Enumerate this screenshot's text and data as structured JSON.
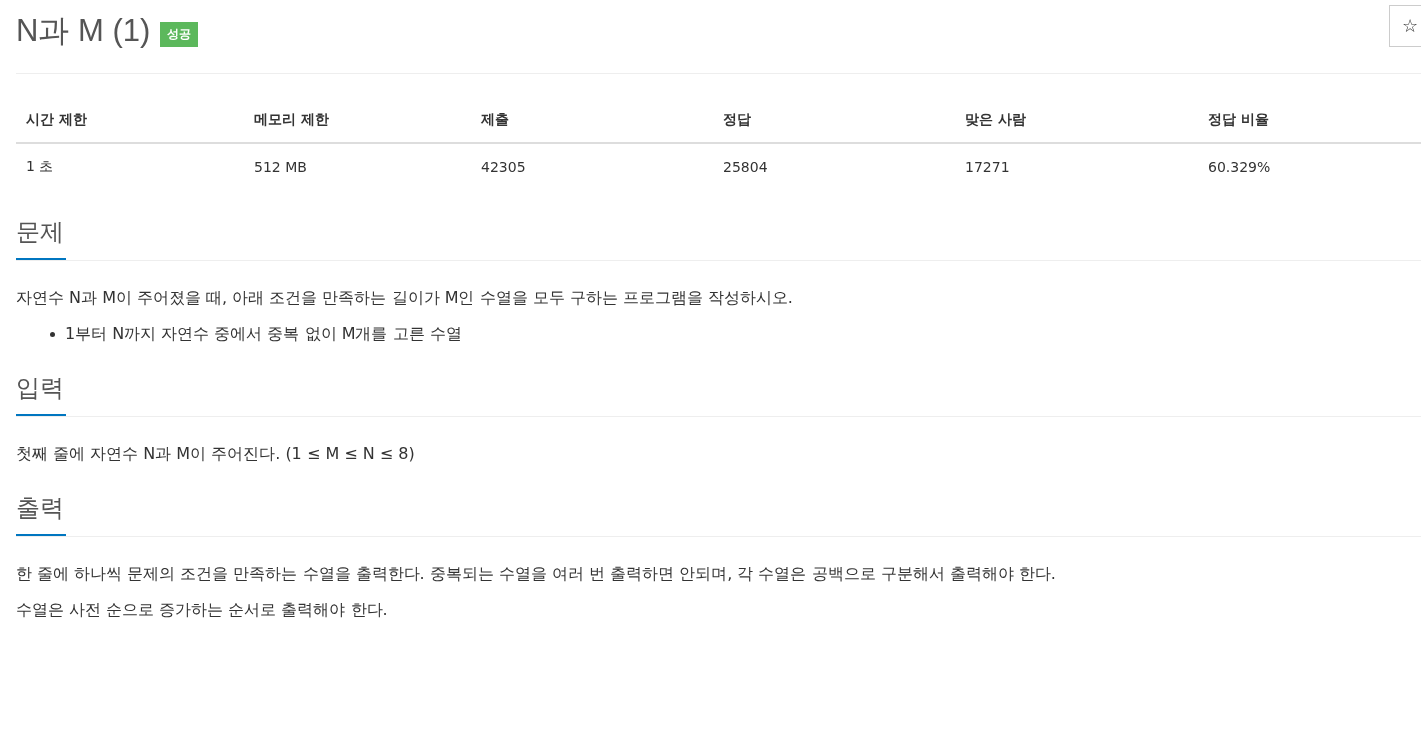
{
  "title": "N과 M (1)",
  "badge": "성공",
  "star_button": "☆",
  "table": {
    "columns": [
      "시간 제한",
      "메모리 제한",
      "제출",
      "정답",
      "맞은 사람",
      "정답 비율"
    ],
    "rows": [
      [
        "1 초",
        "512 MB",
        "42305",
        "25804",
        "17271",
        "60.329%"
      ]
    ]
  },
  "sections": [
    {
      "heading": "문제",
      "blocks": [
        {
          "kind": "paragraph",
          "text": "자연수 N과 M이 주어졌을 때, 아래 조건을 만족하는 길이가 M인 수열을 모두 구하는 프로그램을 작성하시오."
        },
        {
          "kind": "bullets",
          "items": [
            "1부터 N까지 자연수 중에서 중복 없이 M개를 고른 수열"
          ]
        }
      ]
    },
    {
      "heading": "입력",
      "blocks": [
        {
          "kind": "paragraph",
          "text": "첫째 줄에 자연수 N과 M이 주어진다. (1 ≤ M ≤ N ≤ 8)"
        }
      ]
    },
    {
      "heading": "출력",
      "blocks": [
        {
          "kind": "paragraph",
          "text": "한 줄에 하나씩 문제의 조건을 만족하는 수열을 출력한다. 중복되는 수열을 여러 번 출력하면 안되며, 각 수열은 공백으로 구분해서 출력해야 한다."
        },
        {
          "kind": "paragraph",
          "text": "수열은 사전 순으로 증가하는 순서로 출력해야 한다."
        }
      ]
    }
  ]
}
